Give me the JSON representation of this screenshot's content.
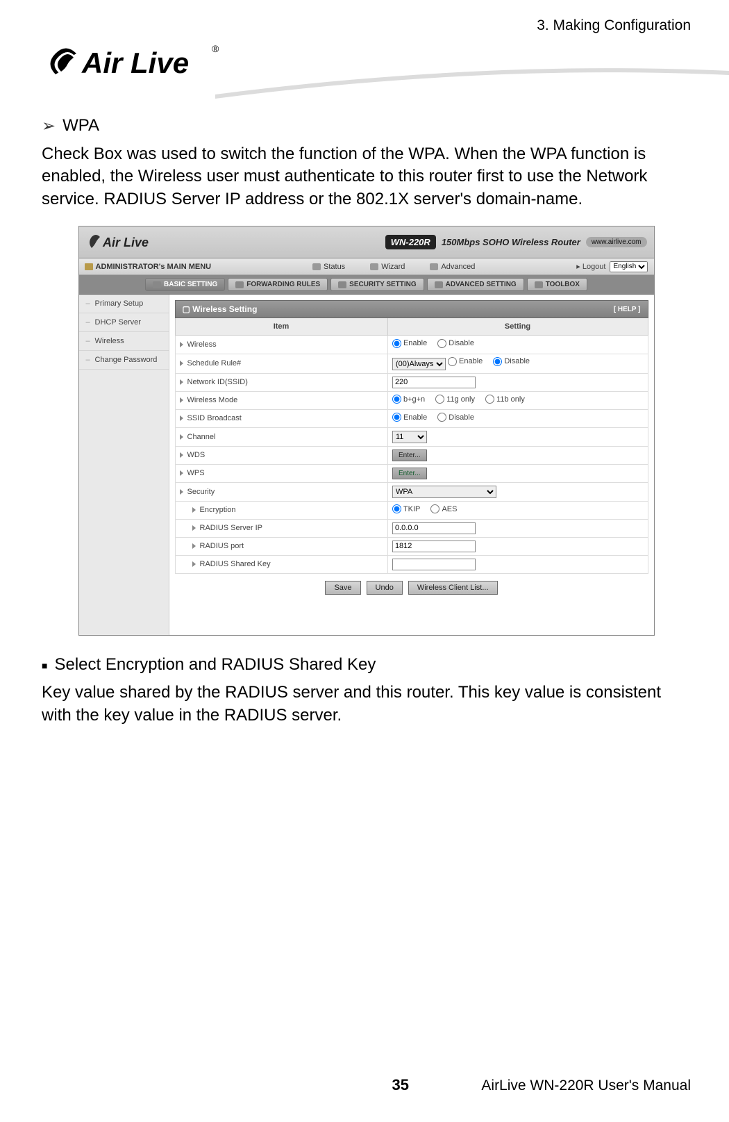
{
  "header": {
    "section": "3. Making Configuration"
  },
  "logo": {
    "text": "Air Live",
    "registered": "®"
  },
  "bullets": {
    "wpa_title": "WPA",
    "wpa_para": "Check Box was used to switch the function of the WPA. When the WPA function is enabled, the Wireless user must authenticate to this router first to use the Network service. RADIUS Server IP address or the 802.1X server's domain-name.",
    "select_title": "Select Encryption and RADIUS Shared Key",
    "select_para": "Key value shared by the RADIUS server and this router. This key value is consistent with the key value in the RADIUS server."
  },
  "shot": {
    "brand": "Air Live",
    "model": "WN-220R",
    "model_sub": "150Mbps SOHO Wireless Router",
    "www": "www.airlive.com",
    "admin_menu": "ADMINISTRATOR's MAIN MENU",
    "menu_items": [
      "Status",
      "Wizard",
      "Advanced"
    ],
    "logout": "Logout",
    "language": "English",
    "tabs": [
      "BASIC SETTING",
      "FORWARDING RULES",
      "SECURITY SETTING",
      "ADVANCED SETTING",
      "TOOLBOX"
    ],
    "sidebar": [
      "Primary Setup",
      "DHCP Server",
      "Wireless",
      "Change Password"
    ],
    "panel_title": "Wireless Setting",
    "help": "[ HELP ]",
    "col_item": "Item",
    "col_setting": "Setting",
    "rows": {
      "wireless": "Wireless",
      "schedule": "Schedule Rule#",
      "ssid": "Network ID(SSID)",
      "mode": "Wireless Mode",
      "broadcast": "SSID Broadcast",
      "channel": "Channel",
      "wds": "WDS",
      "wps": "WPS",
      "security": "Security",
      "encryption": "Encryption",
      "radius_ip": "RADIUS Server IP",
      "radius_port": "RADIUS port",
      "radius_key": "RADIUS Shared Key"
    },
    "values": {
      "enable": "Enable",
      "disable": "Disable",
      "schedule_sel": "(00)Always",
      "ssid_val": "220",
      "mode_bgn": "b+g+n",
      "mode_11g": "11g only",
      "mode_11b": "11b only",
      "channel_val": "11",
      "enter": "Enter...",
      "security_val": "WPA",
      "tkip": "TKIP",
      "aes": "AES",
      "radius_ip_val": "0.0.0.0",
      "radius_port_val": "1812",
      "radius_key_val": ""
    },
    "buttons": {
      "save": "Save",
      "undo": "Undo",
      "clients": "Wireless Client List..."
    }
  },
  "footer": {
    "page": "35",
    "manual": "AirLive WN-220R User's Manual"
  }
}
